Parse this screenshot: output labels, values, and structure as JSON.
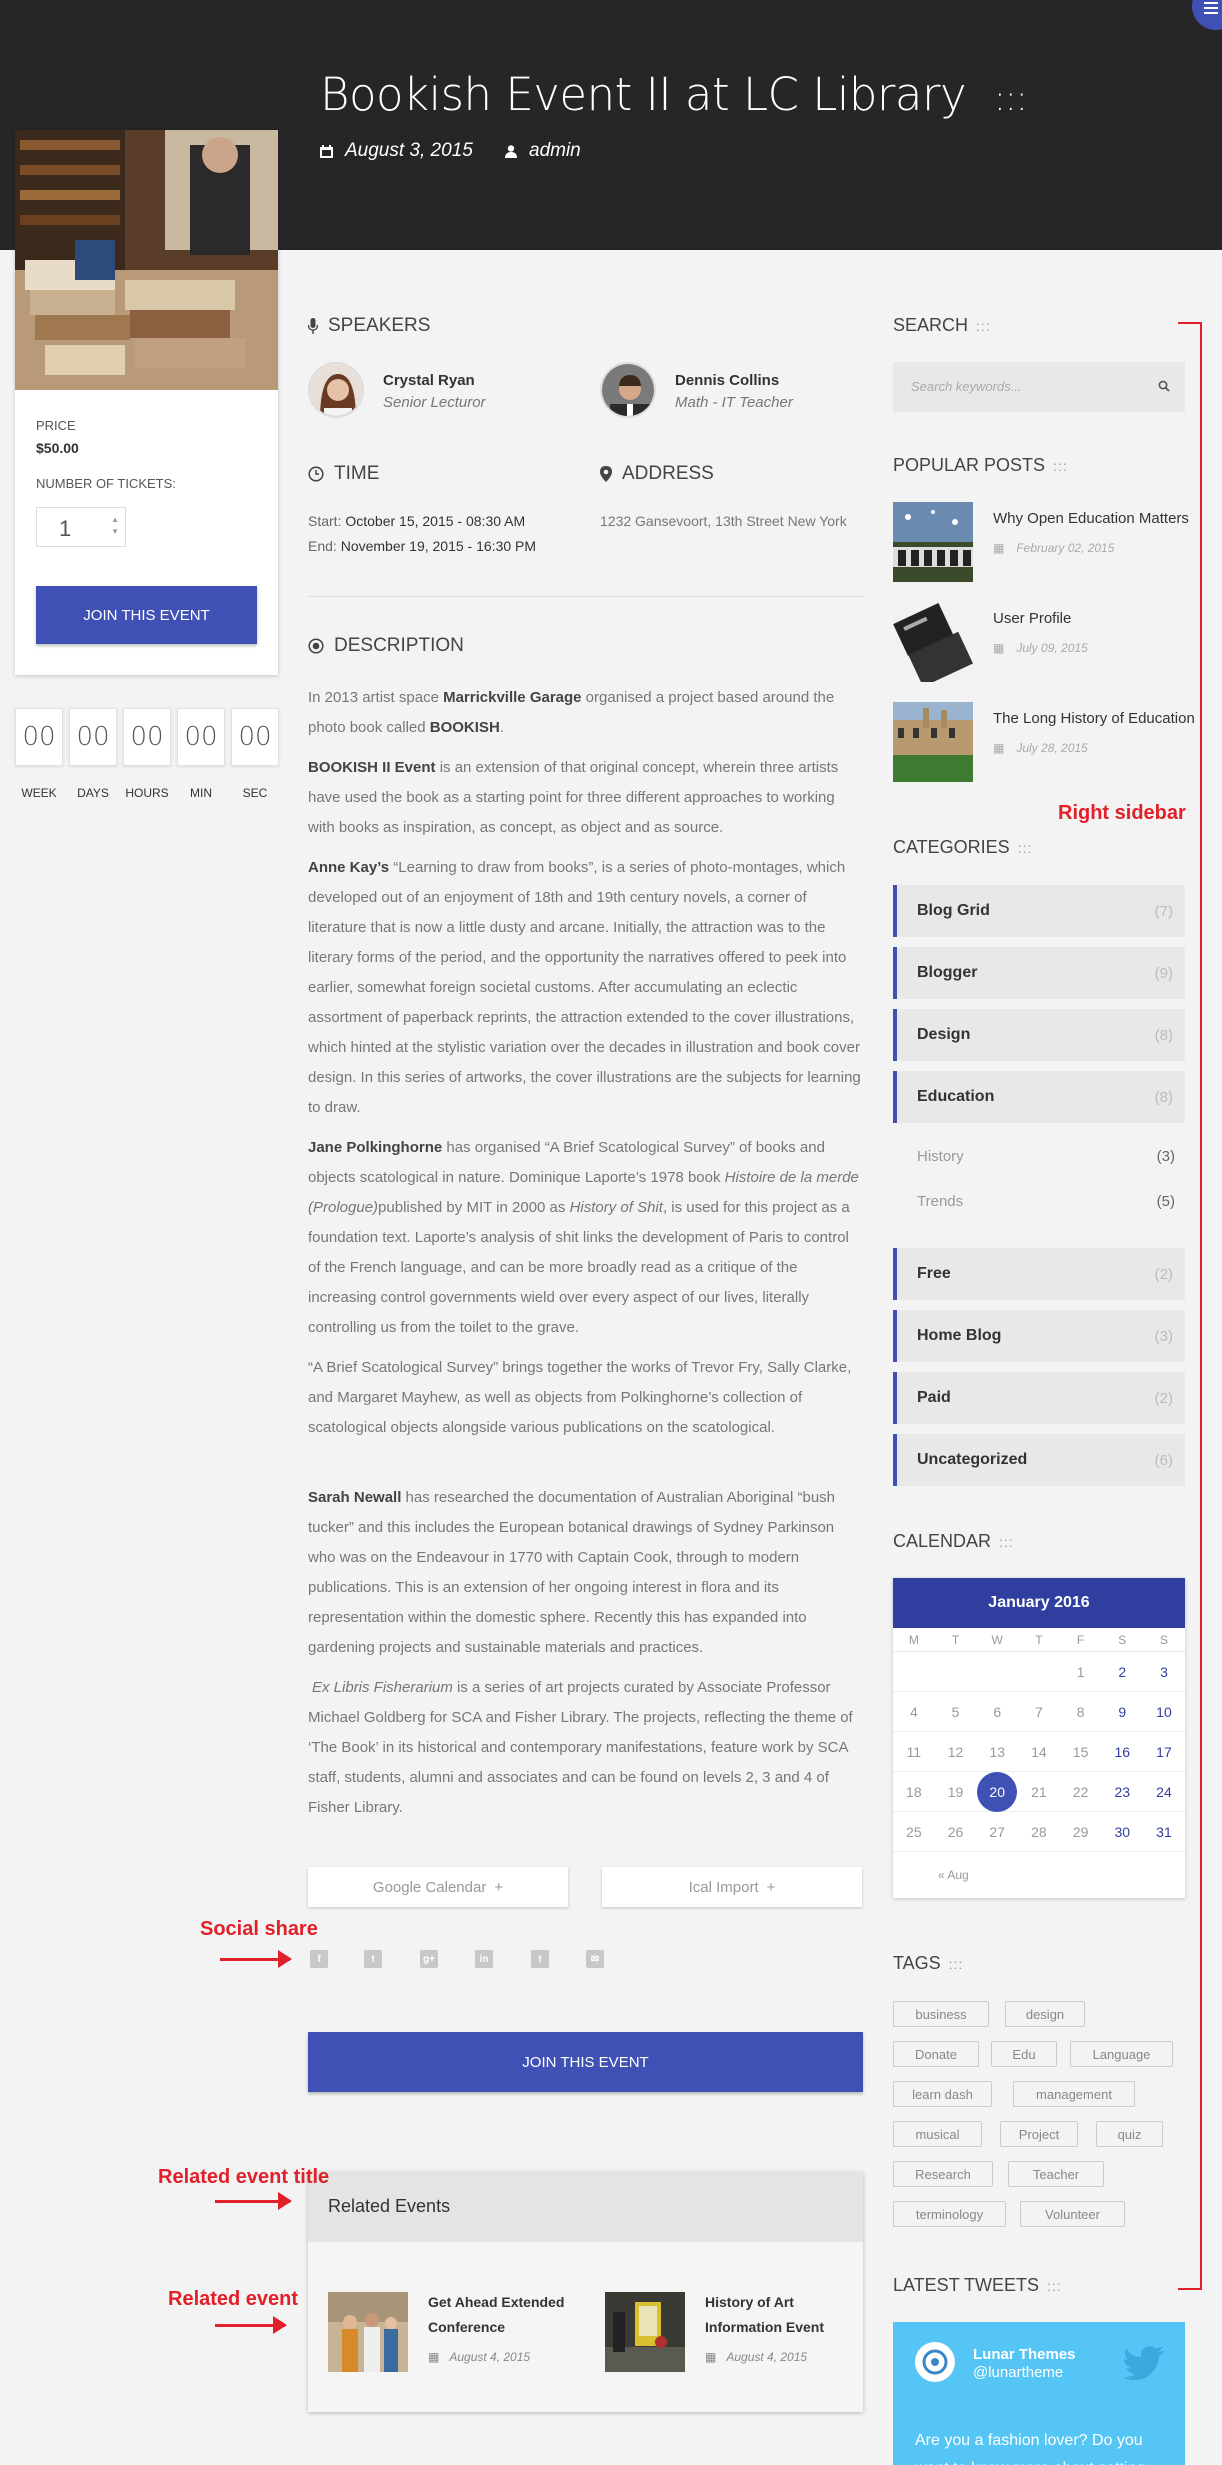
{
  "header": {
    "title": "Bookish Event II at LC Library",
    "title_dots": ":::",
    "date": "August 3, 2015",
    "author": "admin"
  },
  "ticket_card": {
    "price_label": "PRICE",
    "price": "$50.00",
    "tickets_label": "NUMBER OF TICKETS:",
    "tickets_value": "1",
    "join_label": "JOIN THIS EVENT"
  },
  "countdown": {
    "values": [
      "00",
      "00",
      "00",
      "00",
      "00"
    ],
    "labels": [
      "WEEK",
      "DAYS",
      "HOURS",
      "MIN",
      "SEC"
    ]
  },
  "speakers": {
    "heading": "SPEAKERS",
    "items": [
      {
        "name": "Crystal Ryan",
        "role": "Senior Lecturor"
      },
      {
        "name": "Dennis Collins",
        "role": "Math - IT Teacher"
      }
    ]
  },
  "time": {
    "heading": "TIME",
    "start_prefix": "Start: ",
    "start": "October 15, 2015 - 08:30 AM",
    "end_prefix": "End: ",
    "end": "November 19, 2015 - 16:30 PM"
  },
  "address": {
    "heading": "ADDRESS",
    "value": "1232 Gansevoort, 13th Street New York"
  },
  "description": {
    "heading": "DESCRIPTION",
    "p1_a": "In 2013 artist space ",
    "p1_b": "Marrickville Garage",
    "p1_c": " organised a project based around the photo book called ",
    "p1_d": "BOOKISH",
    "p1_e": ".",
    "p2_a": "BOOKISH II Event",
    "p2_b": " is an extension of that original concept, wherein three artists have used the book as a starting point for three different approaches to working with books as inspiration, as concept, as object and as source.",
    "p3_a": "Anne Kay’s",
    "p3_b": " “Learning to draw from books”, is a series of photo-montages, which developed out of an enjoyment of 18th and 19th century novels, a corner of literature that is now a little dusty and arcane. Initially, the attraction was to the literary forms of the period, and the opportunity the narratives offered to peek into earlier, somewhat foreign societal customs. After accumulating an eclectic assortment of paperback reprints, the attraction extended to the cover illustrations, which hinted at the stylistic variation over the decades in illustration and book cover design. In this series of artworks, the cover illustrations are the subjects for learning to draw.",
    "p4_a": "Jane Polkinghorne",
    "p4_b": " has organised “A Brief Scatological Survey” of books and objects scatological in nature. Dominique Laporte’s 1978 book ",
    "p4_c": "Histoire de la merde (Prologue)",
    "p4_d": "published by MIT in 2000 as ",
    "p4_e": "History of Shit",
    "p4_f": ", is used for this project as a foundation text. Laporte’s analysis of shit links the development of Paris to control of the French language, and can be more broadly read as a critique of the increasing control governments wield over every aspect of our lives, literally controlling us from the toilet to the grave.",
    "p5": "“A Brief Scatological Survey” brings together the works of Trevor Fry, Sally Clarke, and Margaret Mayhew, as well as objects from Polkinghorne’s collection of scatological objects alongside various publications on the scatological.",
    "p6_a": "Sarah Newall",
    "p6_b": " has researched the documentation of Australian Aboriginal “bush tucker” and this includes the European botanical drawings of Sydney Parkinson who was on the Endeavour in 1770 with Captain Cook, through to modern publications. This is an extension of her ongoing interest in flora and its representation within the domestic sphere. Recently this has expanded into gardening projects and sustainable materials and practices.",
    "p7_a": "Ex Libris Fisherarium",
    "p7_b": " is a series of art projects curated by Associate Professor Michael Goldberg for SCA and Fisher Library. The projects, reflecting the theme of ‘The Book’ in its historical and contemporary manifestations, feature work by SCA staff, students, alumni and associates and can be found on levels 2, 3 and 4 of Fisher Library."
  },
  "actions": {
    "google_calendar": "Google Calendar",
    "ical_import": "Ical Import",
    "plus": "+",
    "join_label": "JOIN THIS EVENT"
  },
  "social": [
    "f",
    "t",
    "g+",
    "in",
    "t",
    "✉"
  ],
  "annotations": {
    "social_share": "Social share",
    "related_title": "Related event title",
    "related_event": "Related event",
    "right_sidebar": "Right sidebar"
  },
  "related": {
    "heading": "Related Events",
    "items": [
      {
        "title_l1": "Get Ahead Extended",
        "title_l2": "Conference",
        "date": "August 4, 2015"
      },
      {
        "title_l1": "History of Art",
        "title_l2": "Information Event",
        "date": "August 4, 2015"
      }
    ]
  },
  "sidebar": {
    "search_heading": "SEARCH",
    "search_placeholder": "Search keywords...",
    "popular_heading": "POPULAR POSTS",
    "popular": [
      {
        "title": "Why Open Education Matters",
        "date": "February 02, 2015"
      },
      {
        "title": "User Profile",
        "date": "July 09, 2015"
      },
      {
        "title": "The Long History of Education",
        "date": "July 28, 2015"
      }
    ],
    "categories_heading": "CATEGORIES",
    "categories": [
      {
        "name": "Blog Grid",
        "count": "(7)"
      },
      {
        "name": "Blogger",
        "count": "(9)"
      },
      {
        "name": "Design",
        "count": "(8)"
      },
      {
        "name": "Education",
        "count": "(8)"
      },
      {
        "name": "Free",
        "count": "(2)"
      },
      {
        "name": "Home Blog",
        "count": "(3)"
      },
      {
        "name": "Paid",
        "count": "(2)"
      },
      {
        "name": "Uncategorized",
        "count": "(6)"
      }
    ],
    "subcategories": [
      {
        "name": "History",
        "count": "(3)"
      },
      {
        "name": "Trends",
        "count": "(5)"
      }
    ],
    "calendar_heading": "CALENDAR",
    "calendar": {
      "month": "January 2016",
      "dow": [
        "M",
        "T",
        "W",
        "T",
        "F",
        "S",
        "S"
      ],
      "weeks": [
        [
          "",
          "",
          "",
          "",
          "1",
          "2",
          "3"
        ],
        [
          "4",
          "5",
          "6",
          "7",
          "8",
          "9",
          "10"
        ],
        [
          "11",
          "12",
          "13",
          "14",
          "15",
          "16",
          "17"
        ],
        [
          "18",
          "19",
          "20",
          "21",
          "22",
          "23",
          "24"
        ],
        [
          "25",
          "26",
          "27",
          "28",
          "29",
          "30",
          "31"
        ]
      ],
      "today": "20",
      "prev": "« Aug"
    },
    "tags_heading": "TAGS",
    "tags": [
      "business",
      "design",
      "Donate",
      "Edu",
      "Language",
      "learn dash",
      "management",
      "musical",
      "Project",
      "quiz",
      "Research",
      "Teacher",
      "terminology",
      "Volunteer"
    ],
    "tweets_heading": "LATEST TWEETS",
    "tweet_name": "Lunar Themes",
    "tweet_handle": "@lunartheme",
    "tweet_text": "Are you a fashion lover? Do you want to know more about setting"
  },
  "colors": {
    "accent": "#3f51b5",
    "header_bg": "#262626",
    "annotation": "#e2202a",
    "tweet_bg": "#55c5f5"
  }
}
